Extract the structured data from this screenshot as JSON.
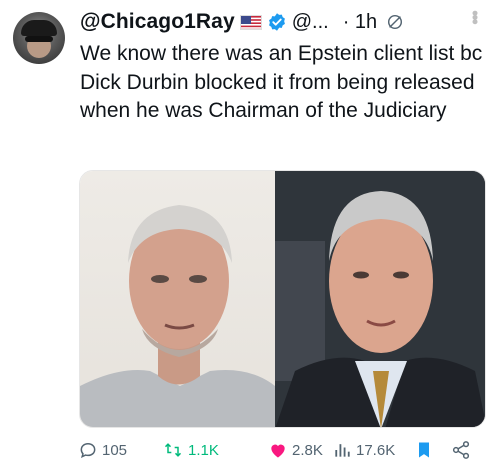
{
  "tweet": {
    "display_name": "@Chicago1Ray",
    "handle": "@...",
    "time": "· 1h",
    "text": "We know there was an Epstein client list bc Dick Durbin blocked it from being released when he was Chairman of the Judiciary",
    "images": [
      {
        "icon": "portrait-photo-left"
      },
      {
        "icon": "portrait-photo-right"
      }
    ]
  },
  "actions": {
    "replies": "105",
    "retweets": "1.1K",
    "likes": "2.8K",
    "views": "17.6K"
  },
  "colors": {
    "text": "#0f1419",
    "secondary": "#536471",
    "verified": "#1d9bf0",
    "retweet": "#00ba7c",
    "like": "#f91880",
    "bookmark": "#1d9bf0"
  }
}
